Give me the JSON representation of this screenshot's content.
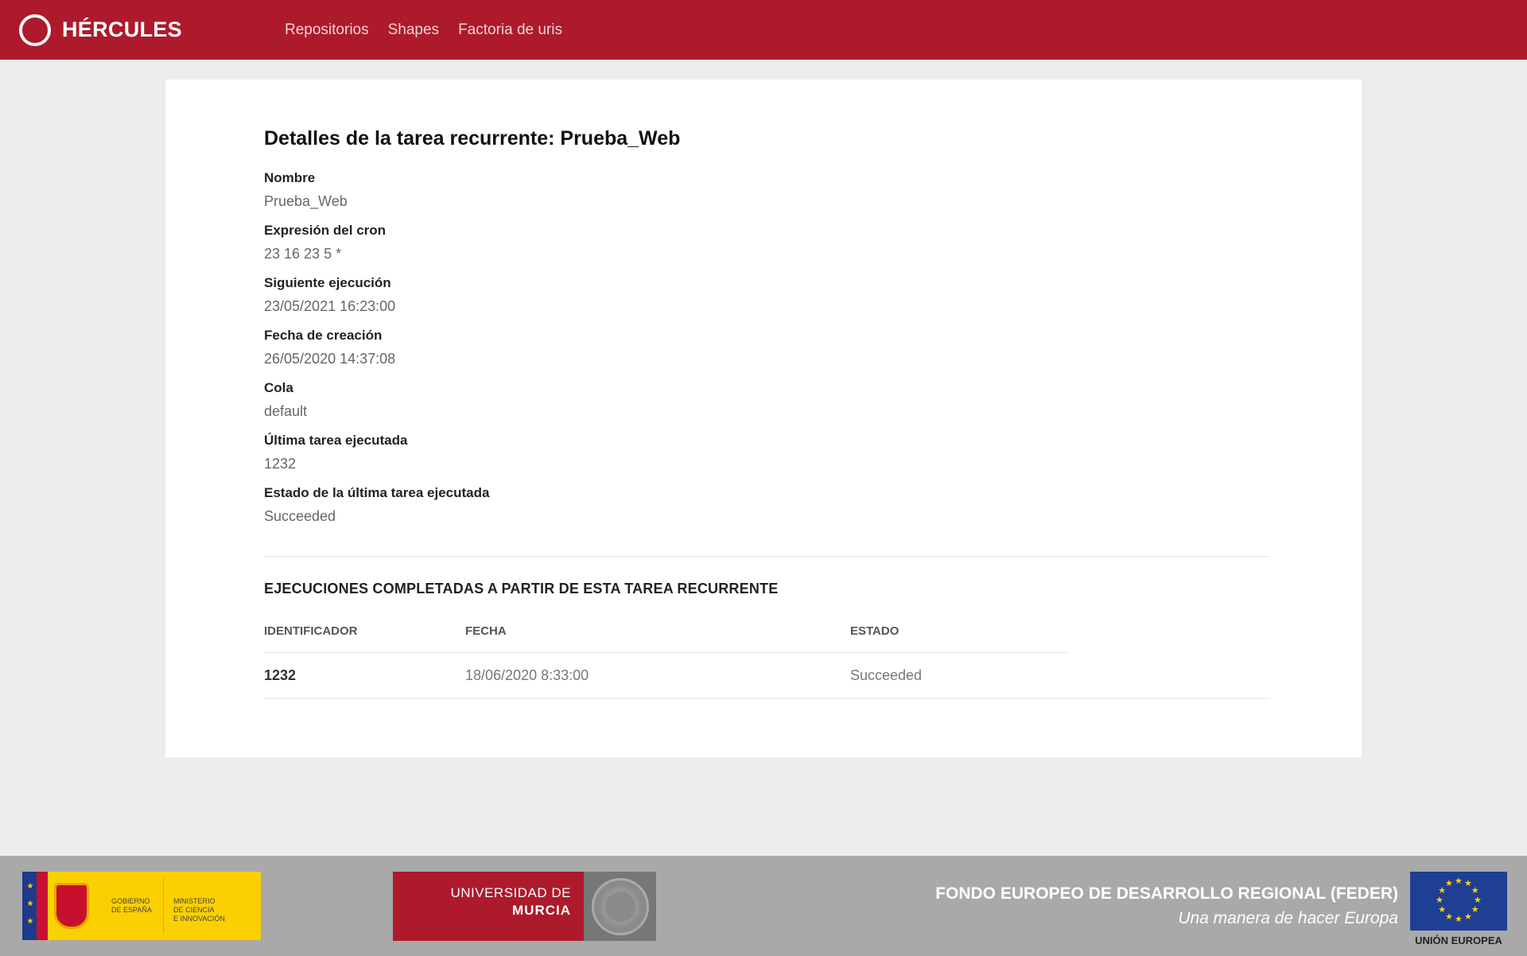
{
  "header": {
    "brand": "HÉRCULES",
    "nav": [
      "Repositorios",
      "Shapes",
      "Factoria de uris"
    ]
  },
  "page": {
    "title": "Detalles de la tarea recurrente: Prueba_Web",
    "fields": [
      {
        "label": "Nombre",
        "value": "Prueba_Web"
      },
      {
        "label": "Expresión del cron",
        "value": "23 16 23 5 *"
      },
      {
        "label": "Siguiente ejecución",
        "value": "23/05/2021 16:23:00"
      },
      {
        "label": "Fecha de creación",
        "value": "26/05/2020 14:37:08"
      },
      {
        "label": "Cola",
        "value": "default"
      },
      {
        "label": "Última tarea ejecutada",
        "value": "1232"
      },
      {
        "label": "Estado de la última tarea ejecutada",
        "value": "Succeeded"
      }
    ],
    "executions": {
      "title": "EJECUCIONES COMPLETADAS A PARTIR DE ESTA TAREA RECURRENTE",
      "columns": [
        "IDENTIFICADOR",
        "FECHA",
        "ESTADO"
      ],
      "rows": [
        {
          "id": "1232",
          "fecha": "18/06/2020 8:33:00",
          "estado": "Succeeded"
        }
      ]
    }
  },
  "footer": {
    "gov": {
      "line1": "GOBIERNO",
      "line2": "DE ESPAÑA",
      "ministry1": "MINISTERIO",
      "ministry2": "DE CIENCIA",
      "ministry3": "E INNOVACIÓN"
    },
    "um": {
      "line1": "UNIVERSIDAD DE",
      "line2": "MURCIA"
    },
    "feder_title": "FONDO EUROPEO DE DESARROLLO REGIONAL (FEDER)",
    "feder_sub": "Una manera de hacer Europa",
    "eu_label": "UNIÓN EUROPEA"
  },
  "colors": {
    "brand": "#ad1a2c",
    "background": "#ededed",
    "footer": "#a9a9a9"
  }
}
